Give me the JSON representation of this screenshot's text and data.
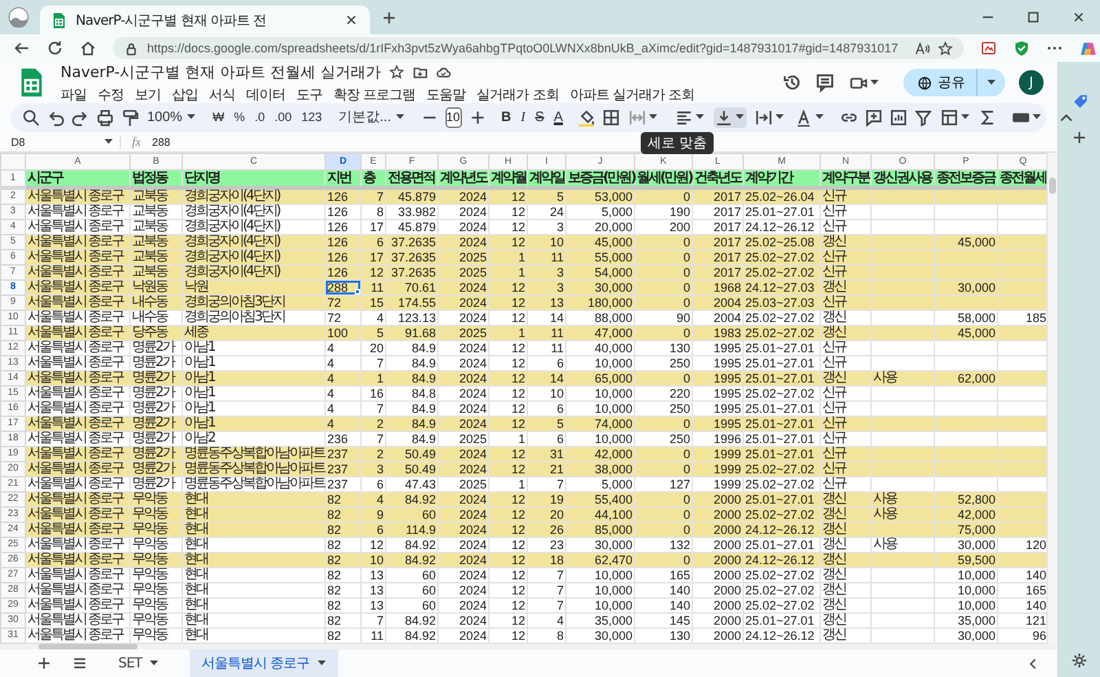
{
  "browser": {
    "tab_title": "NaverP-시군구별 현재 아파트 전",
    "url": "https://docs.google.com/spreadsheets/d/1rIFxh3pvt5zWya6ahbgTPqtoO0LWNXx8bnUkB_aXimc/edit?gid=1487931017#gid=1487931017"
  },
  "document": {
    "title": "NaverP-시군구별 현재 아파트 전월세 실거래가",
    "menu": [
      "파일",
      "수정",
      "보기",
      "삽입",
      "서식",
      "데이터",
      "도구",
      "확장 프로그램",
      "도움말",
      "실거래가 조회",
      "아파트 실거래가 조회"
    ],
    "share_label": "공유",
    "avatar": "J"
  },
  "toolbar": [
    {
      "kind": "dropdown",
      "label": "100%"
    },
    {
      "kind": "plain",
      "label": "₩"
    },
    {
      "kind": "plain",
      "label": "%"
    },
    {
      "kind": "plain",
      "label": ".0"
    },
    {
      "kind": "plain",
      "label": ".00"
    },
    {
      "kind": "plain",
      "label": "123"
    },
    {
      "kind": "dropdown",
      "label": "기본값..."
    },
    {
      "kind": "field",
      "label": "10"
    },
    {
      "kind": "bold",
      "label": "B"
    },
    {
      "kind": "italic",
      "label": "I"
    },
    {
      "kind": "strike",
      "label": "S"
    },
    {
      "kind": "underline",
      "label": "A"
    }
  ],
  "tooltip": "세로 맞춤",
  "formula_bar": {
    "cell": "D8",
    "function_label": "fx",
    "value": "288"
  },
  "sheet": {
    "columns": [
      {
        "letter": "A",
        "selected": false
      },
      {
        "letter": "B",
        "selected": false
      },
      {
        "letter": "C",
        "selected": false
      },
      {
        "letter": "D",
        "selected": true
      },
      {
        "letter": "E",
        "selected": false
      },
      {
        "letter": "F",
        "selected": false
      },
      {
        "letter": "G",
        "selected": false
      },
      {
        "letter": "H",
        "selected": false
      },
      {
        "letter": "I",
        "selected": false
      },
      {
        "letter": "J",
        "selected": false
      },
      {
        "letter": "K",
        "selected": false
      },
      {
        "letter": "L",
        "selected": false
      },
      {
        "letter": "M",
        "selected": false
      },
      {
        "letter": "N",
        "selected": false
      },
      {
        "letter": "O",
        "selected": false
      },
      {
        "letter": "P",
        "selected": false
      },
      {
        "letter": "Q",
        "selected": false
      }
    ],
    "rows": [
      {
        "kind": "header",
        "number": "1",
        "selected": false,
        "cells": [
          "시군구",
          "법정동",
          "단지명",
          "지번",
          "층",
          "전용면적",
          "계약년도",
          "계약월",
          "계약일",
          "보증금(만원)",
          "월세(만원)",
          "건축년도",
          "계약기간",
          "계약구분",
          "갱신권사용",
          "종전보증금",
          "종전월세"
        ]
      },
      {
        "kind": "data",
        "number": "2",
        "selected": false,
        "highlighted": true,
        "cells": [
          "서울특별시 종로구",
          "교북동",
          "경희궁자이(4단지)",
          "126",
          "7",
          "45.879",
          "2024",
          "12",
          "5",
          "53,000",
          "0",
          "2017",
          "25.02~26.04",
          "신규"
        ]
      },
      {
        "kind": "data",
        "number": "3",
        "selected": false,
        "highlighted": false,
        "cells": [
          "서울특별시 종로구",
          "교북동",
          "경희궁자이(4단지)",
          "126",
          "8",
          "33.982",
          "2024",
          "12",
          "24",
          "5,000",
          "190",
          "2017",
          "25.01~27.01",
          "신규"
        ]
      },
      {
        "kind": "data",
        "number": "4",
        "selected": false,
        "highlighted": false,
        "cells": [
          "서울특별시 종로구",
          "교북동",
          "경희궁자이(4단지)",
          "126",
          "17",
          "45.879",
          "2024",
          "12",
          "3",
          "20,000",
          "200",
          "2017",
          "24.12~26.12",
          "신규"
        ]
      },
      {
        "kind": "data",
        "number": "5",
        "selected": false,
        "highlighted": true,
        "cells": [
          "서울특별시 종로구",
          "교북동",
          "경희궁자이(4단지)",
          "126",
          "6",
          "37.2635",
          "2024",
          "12",
          "10",
          "45,000",
          "0",
          "2017",
          "25.02~25.08",
          "갱신",
          null,
          "45,000"
        ]
      },
      {
        "kind": "data",
        "number": "6",
        "selected": false,
        "highlighted": true,
        "cells": [
          "서울특별시 종로구",
          "교북동",
          "경희궁자이(4단지)",
          "126",
          "17",
          "37.2635",
          "2025",
          "1",
          "11",
          "55,000",
          "0",
          "2017",
          "25.02~27.02",
          "신규"
        ]
      },
      {
        "kind": "data",
        "number": "7",
        "selected": false,
        "highlighted": true,
        "cells": [
          "서울특별시 종로구",
          "교북동",
          "경희궁자이(4단지)",
          "126",
          "12",
          "37.2635",
          "2025",
          "1",
          "3",
          "54,000",
          "0",
          "2017",
          "25.02~27.02",
          "신규"
        ]
      },
      {
        "kind": "data",
        "number": "8",
        "selected": true,
        "highlighted": true,
        "cells": [
          "서울특별시 종로구",
          "낙원동",
          "낙원",
          "288",
          "11",
          "70.61",
          "2024",
          "12",
          "3",
          "30,000",
          "0",
          "1968",
          "24.12~27.03",
          "갱신",
          null,
          "30,000"
        ]
      },
      {
        "kind": "data",
        "number": "9",
        "selected": false,
        "highlighted": true,
        "cells": [
          "서울특별시 종로구",
          "내수동",
          "경희궁의아침3단지",
          "72",
          "15",
          "174.55",
          "2024",
          "12",
          "13",
          "180,000",
          "0",
          "2004",
          "25.03~27.03",
          "신규"
        ]
      },
      {
        "kind": "data",
        "number": "10",
        "selected": false,
        "highlighted": false,
        "cells": [
          "서울특별시 종로구",
          "내수동",
          "경희궁의아침3단지",
          "72",
          "4",
          "123.13",
          "2024",
          "12",
          "14",
          "88,000",
          "90",
          "2004",
          "25.02~27.02",
          "갱신",
          null,
          "58,000",
          "185"
        ]
      },
      {
        "kind": "data",
        "number": "11",
        "selected": false,
        "highlighted": true,
        "cells": [
          "서울특별시 종로구",
          "당주동",
          "세종",
          "100",
          "5",
          "91.68",
          "2025",
          "1",
          "11",
          "47,000",
          "0",
          "1983",
          "25.02~27.02",
          "갱신",
          null,
          "45,000"
        ]
      },
      {
        "kind": "data",
        "number": "12",
        "selected": false,
        "highlighted": false,
        "cells": [
          "서울특별시 종로구",
          "명륜2가",
          "아남1",
          "4",
          "20",
          "84.9",
          "2024",
          "12",
          "11",
          "40,000",
          "130",
          "1995",
          "25.01~27.01",
          "신규"
        ]
      },
      {
        "kind": "data",
        "number": "13",
        "selected": false,
        "highlighted": false,
        "cells": [
          "서울특별시 종로구",
          "명륜2가",
          "아남1",
          "4",
          "7",
          "84.9",
          "2024",
          "12",
          "6",
          "10,000",
          "250",
          "1995",
          "25.01~27.01",
          "신규"
        ]
      },
      {
        "kind": "data",
        "number": "14",
        "selected": false,
        "highlighted": true,
        "cells": [
          "서울특별시 종로구",
          "명륜2가",
          "아남1",
          "4",
          "1",
          "84.9",
          "2024",
          "12",
          "14",
          "65,000",
          "0",
          "1995",
          "25.01~27.01",
          "갱신",
          "사용",
          "62,000"
        ]
      },
      {
        "kind": "data",
        "number": "15",
        "selected": false,
        "highlighted": false,
        "cells": [
          "서울특별시 종로구",
          "명륜2가",
          "아남1",
          "4",
          "16",
          "84.8",
          "2024",
          "12",
          "10",
          "10,000",
          "220",
          "1995",
          "25.02~27.02",
          "신규"
        ]
      },
      {
        "kind": "data",
        "number": "16",
        "selected": false,
        "highlighted": false,
        "cells": [
          "서울특별시 종로구",
          "명륜2가",
          "아남1",
          "4",
          "7",
          "84.9",
          "2024",
          "12",
          "6",
          "10,000",
          "250",
          "1995",
          "25.01~27.01",
          "신규"
        ]
      },
      {
        "kind": "data",
        "number": "17",
        "selected": false,
        "highlighted": true,
        "cells": [
          "서울특별시 종로구",
          "명륜2가",
          "아남1",
          "4",
          "2",
          "84.9",
          "2024",
          "12",
          "5",
          "74,000",
          "0",
          "1995",
          "25.01~27.01",
          "신규"
        ]
      },
      {
        "kind": "data",
        "number": "18",
        "selected": false,
        "highlighted": false,
        "cells": [
          "서울특별시 종로구",
          "명륜2가",
          "아남2",
          "236",
          "7",
          "84.9",
          "2025",
          "1",
          "6",
          "10,000",
          "250",
          "1996",
          "25.01~27.01",
          "신규"
        ]
      },
      {
        "kind": "data",
        "number": "19",
        "selected": false,
        "highlighted": true,
        "cells": [
          "서울특별시 종로구",
          "명륜2가",
          "명륜동주상복합아남아파트",
          "237",
          "2",
          "50.49",
          "2024",
          "12",
          "31",
          "42,000",
          "0",
          "1999",
          "25.01~27.01",
          "신규"
        ]
      },
      {
        "kind": "data",
        "number": "20",
        "selected": false,
        "highlighted": true,
        "cells": [
          "서울특별시 종로구",
          "명륜2가",
          "명륜동주상복합아남아파트",
          "237",
          "3",
          "50.49",
          "2024",
          "12",
          "21",
          "38,000",
          "0",
          "1999",
          "25.02~27.02",
          "신규"
        ]
      },
      {
        "kind": "data",
        "number": "21",
        "selected": false,
        "highlighted": false,
        "cells": [
          "서울특별시 종로구",
          "명륜2가",
          "명륜동주상복합아남아파트",
          "237",
          "6",
          "47.43",
          "2025",
          "1",
          "7",
          "5,000",
          "127",
          "1999",
          "25.02~27.02",
          "신규"
        ]
      },
      {
        "kind": "data",
        "number": "22",
        "selected": false,
        "highlighted": true,
        "cells": [
          "서울특별시 종로구",
          "무악동",
          "현대",
          "82",
          "4",
          "84.92",
          "2024",
          "12",
          "19",
          "55,400",
          "0",
          "2000",
          "25.01~27.01",
          "갱신",
          "사용",
          "52,800"
        ]
      },
      {
        "kind": "data",
        "number": "23",
        "selected": false,
        "highlighted": true,
        "cells": [
          "서울특별시 종로구",
          "무악동",
          "현대",
          "82",
          "9",
          "60",
          "2024",
          "12",
          "20",
          "44,100",
          "0",
          "2000",
          "25.02~27.02",
          "갱신",
          "사용",
          "42,000"
        ]
      },
      {
        "kind": "data",
        "number": "24",
        "selected": false,
        "highlighted": true,
        "cells": [
          "서울특별시 종로구",
          "무악동",
          "현대",
          "82",
          "6",
          "114.9",
          "2024",
          "12",
          "26",
          "85,000",
          "0",
          "2000",
          "24.12~26.12",
          "갱신",
          null,
          "75,000"
        ]
      },
      {
        "kind": "data",
        "number": "25",
        "selected": false,
        "highlighted": false,
        "cells": [
          "서울특별시 종로구",
          "무악동",
          "현대",
          "82",
          "12",
          "84.92",
          "2024",
          "12",
          "23",
          "30,000",
          "132",
          "2000",
          "25.01~27.01",
          "갱신",
          "사용",
          "30,000",
          "120"
        ]
      },
      {
        "kind": "data",
        "number": "26",
        "selected": false,
        "highlighted": true,
        "cells": [
          "서울특별시 종로구",
          "무악동",
          "현대",
          "82",
          "10",
          "84.92",
          "2024",
          "12",
          "18",
          "62,470",
          "0",
          "2000",
          "24.12~26.12",
          "갱신",
          null,
          "59,500"
        ]
      },
      {
        "kind": "data",
        "number": "27",
        "selected": false,
        "highlighted": false,
        "cells": [
          "서울특별시 종로구",
          "무악동",
          "현대",
          "82",
          "13",
          "60",
          "2024",
          "12",
          "7",
          "10,000",
          "165",
          "2000",
          "25.02~27.02",
          "갱신",
          null,
          "10,000",
          "140"
        ]
      },
      {
        "kind": "data",
        "number": "28",
        "selected": false,
        "highlighted": false,
        "cells": [
          "서울특별시 종로구",
          "무악동",
          "현대",
          "82",
          "13",
          "60",
          "2024",
          "12",
          "7",
          "10,000",
          "140",
          "2000",
          "25.02~27.02",
          "갱신",
          null,
          "10,000",
          "165"
        ]
      },
      {
        "kind": "data",
        "number": "29",
        "selected": false,
        "highlighted": false,
        "cells": [
          "서울특별시 종로구",
          "무악동",
          "현대",
          "82",
          "13",
          "60",
          "2024",
          "12",
          "7",
          "10,000",
          "140",
          "2000",
          "25.02~27.02",
          "갱신",
          null,
          "10,000",
          "140"
        ]
      },
      {
        "kind": "data",
        "number": "30",
        "selected": false,
        "highlighted": false,
        "cells": [
          "서울특별시 종로구",
          "무악동",
          "현대",
          "82",
          "7",
          "84.92",
          "2024",
          "12",
          "4",
          "35,000",
          "145",
          "2000",
          "25.01~27.01",
          "갱신",
          null,
          "35,000",
          "121"
        ]
      },
      {
        "kind": "data",
        "number": "31",
        "selected": false,
        "highlighted": false,
        "cells": [
          "서울특별시 종로구",
          "무악동",
          "현대",
          "82",
          "11",
          "84.92",
          "2024",
          "12",
          "8",
          "30,000",
          "130",
          "2000",
          "24.12~26.12",
          "갱신",
          null,
          "30,000",
          "96"
        ]
      }
    ]
  },
  "sheet_tabs": [
    {
      "label": "SET",
      "selected": false
    },
    {
      "label": "서울특별시 종로구",
      "selected": true
    }
  ]
}
